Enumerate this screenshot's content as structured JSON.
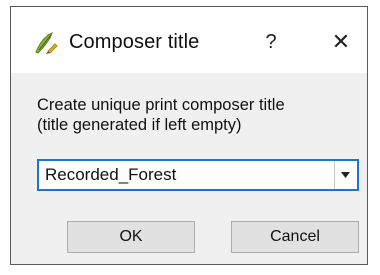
{
  "window": {
    "title": "Composer title",
    "help_label": "?",
    "close_label": "✕",
    "icon": "qgis-composer-icon"
  },
  "prompt": {
    "line1": "Create unique print composer title",
    "line2": "(title generated if left empty)"
  },
  "combo": {
    "value": "Recorded_Forest",
    "dropdown_icon": "chevron-down-icon"
  },
  "buttons": {
    "ok_label": "OK",
    "cancel_label": "Cancel"
  },
  "colors": {
    "focus_border": "#1a73d8",
    "dialog_bg": "#f0f0f0",
    "button_bg": "#e1e1e1"
  }
}
